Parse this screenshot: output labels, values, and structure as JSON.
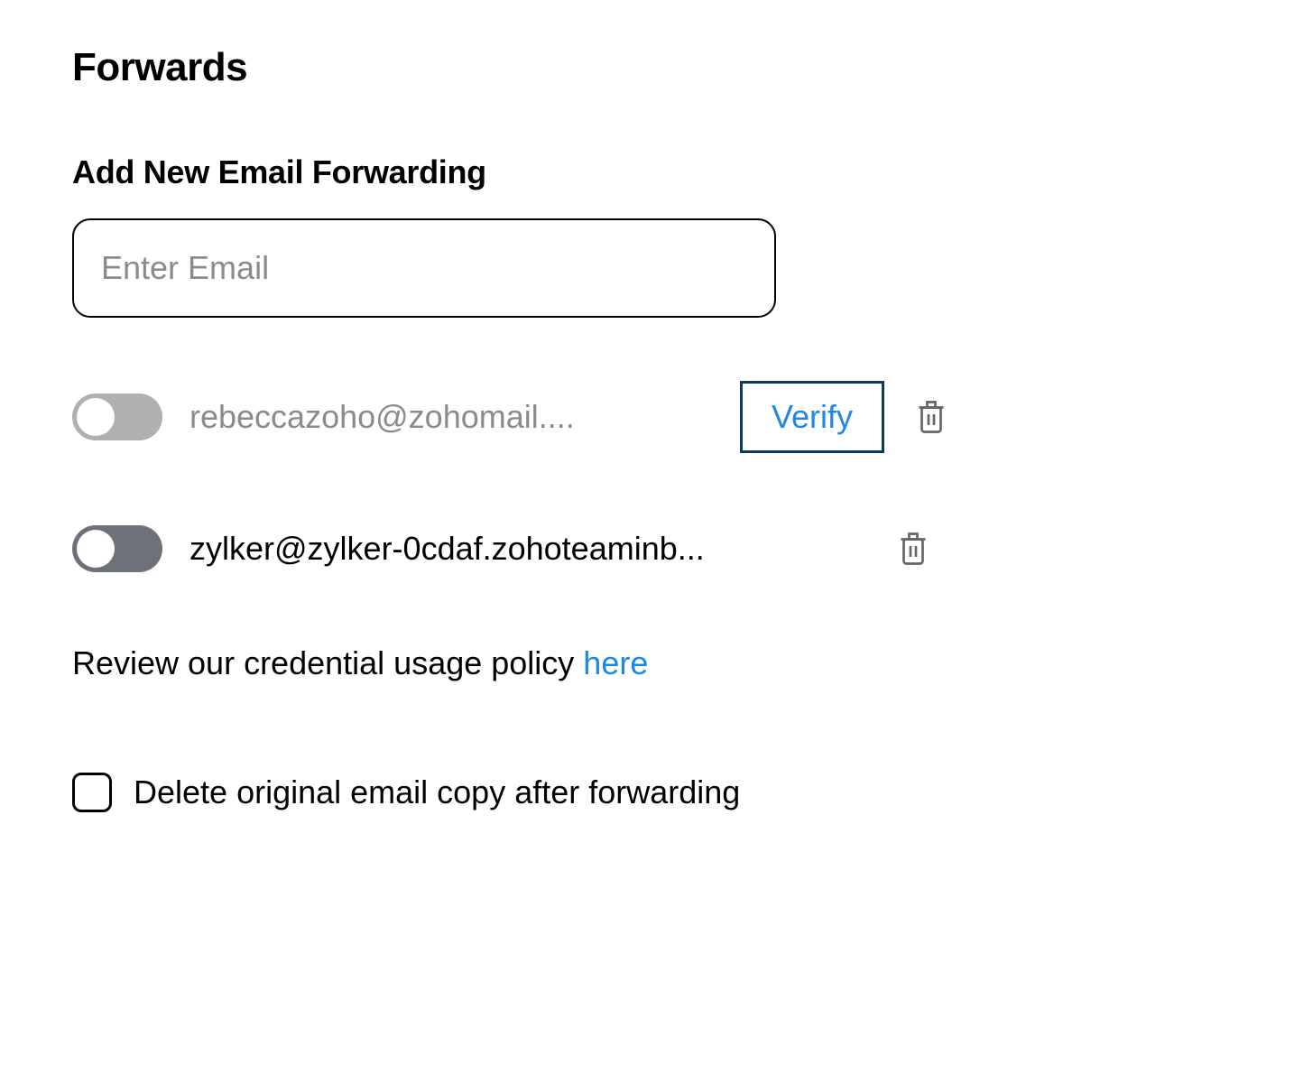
{
  "page_title": "Forwards",
  "add_section": {
    "label": "Add New Email Forwarding",
    "placeholder": "Enter Email"
  },
  "forwards": [
    {
      "email": "rebeccazoho@zohomail....",
      "active": false,
      "needs_verify": true,
      "verify_label": "Verify"
    },
    {
      "email": "zylker@zylker-0cdaf.zohoteaminb...",
      "active": false,
      "needs_verify": false
    }
  ],
  "policy": {
    "text": "Review our credential usage policy ",
    "link_label": "here"
  },
  "delete_option": {
    "label": "Delete original email copy after forwarding",
    "checked": false
  }
}
